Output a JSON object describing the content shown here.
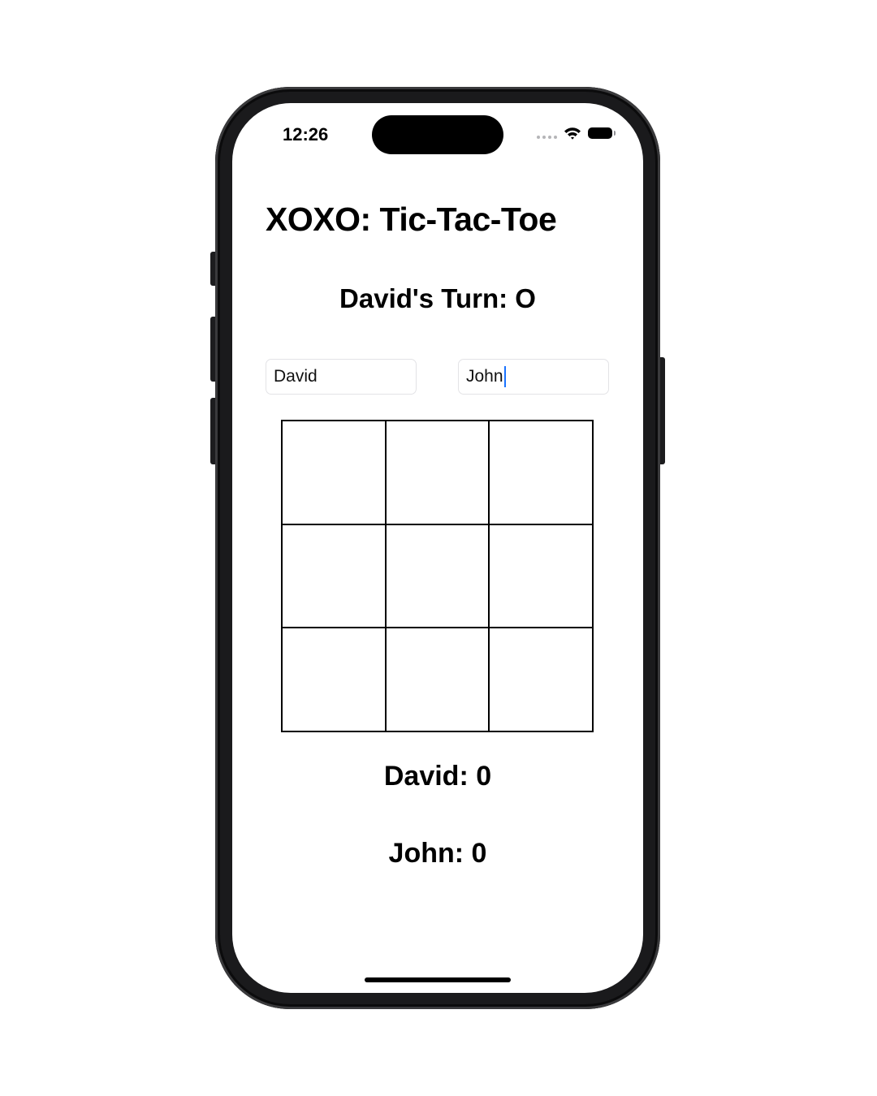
{
  "status_bar": {
    "time": "12:26"
  },
  "app": {
    "title": "XOXO: Tic-Tac-Toe",
    "turn_label": "David's Turn: O"
  },
  "players": {
    "player1_name": "David",
    "player2_name": "John"
  },
  "board": {
    "cells": [
      "",
      "",
      "",
      "",
      "",
      "",
      "",
      "",
      ""
    ]
  },
  "scores": {
    "player1": "David: 0",
    "player2": "John: 0"
  },
  "colors": {
    "caret": "#1a73ff",
    "text": "#000000",
    "frame": "#1a1a1c"
  }
}
